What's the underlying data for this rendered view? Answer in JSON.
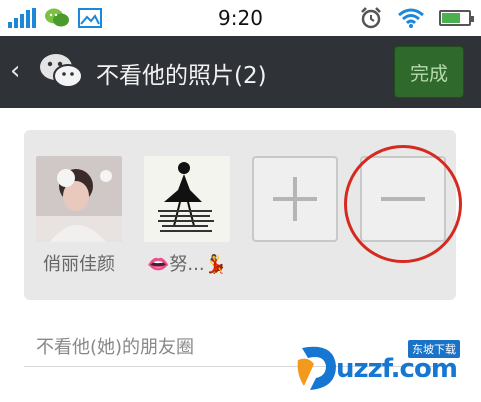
{
  "status_bar": {
    "time": "9:20",
    "battery_level": 0.7,
    "icons": [
      "signal-icon",
      "wechat-notification-icon",
      "image-icon",
      "alarm-icon",
      "wifi-icon",
      "battery-icon"
    ]
  },
  "header": {
    "back_icon": "chevron-left-icon",
    "logo_icon": "wechat-logo-icon",
    "title": "不看他的照片(2)",
    "done_label": "完成",
    "done_color": "#2f6a2c"
  },
  "members": [
    {
      "name": "俏丽佳颜",
      "avatar": "avatar-photo"
    },
    {
      "name": "👄努...💃",
      "avatar": "avatar-photo"
    }
  ],
  "actions": {
    "add_icon": "plus-icon",
    "remove_icon": "minus-icon"
  },
  "section": {
    "label": "不看他(她)的朋友圈"
  },
  "watermark": {
    "text": "uzzf.com",
    "badge": "东坡下载"
  },
  "annotation": {
    "highlight_color": "#d42a20"
  }
}
